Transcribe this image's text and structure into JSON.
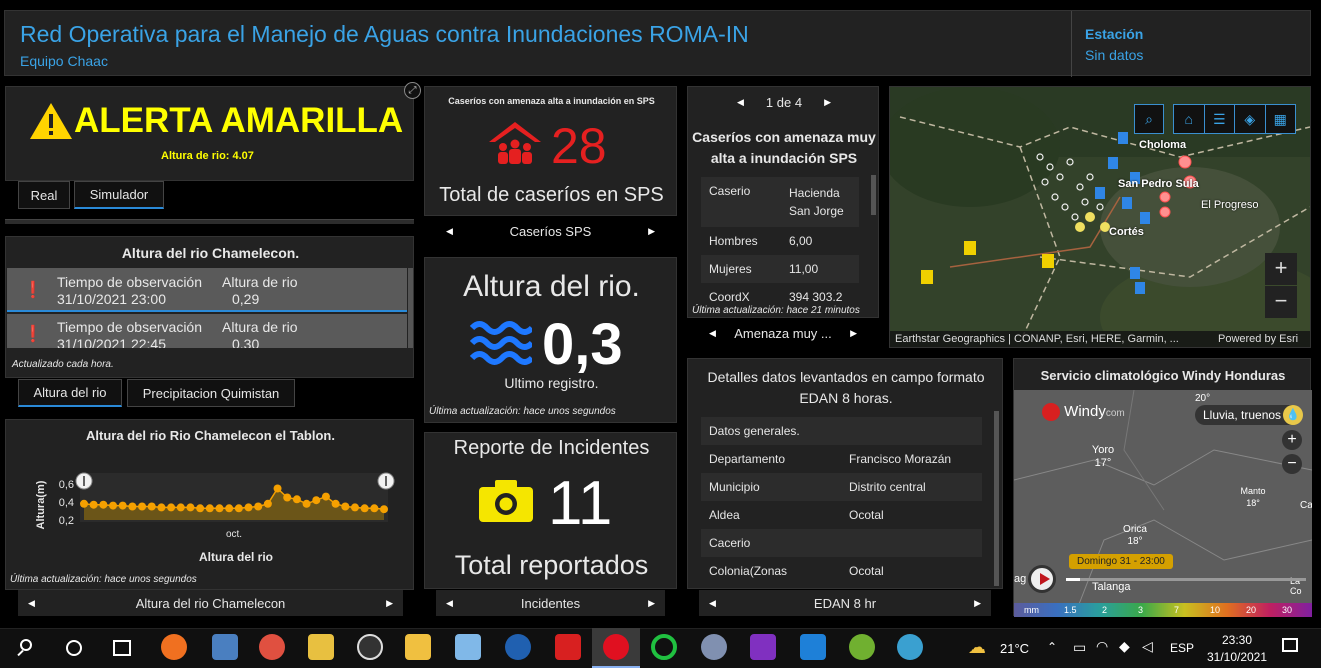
{
  "header": {
    "title": "Red Operativa para el Manejo de Aguas contra Inundaciones ROMA-IN",
    "subtitle": "Equipo Chaac",
    "station_label": "Estación",
    "station_value": "Sin datos"
  },
  "alert": {
    "title": "ALERTA AMARILLA",
    "level_text": "Altura de rio: 4.07",
    "tabs": [
      "Real",
      "Simulador"
    ]
  },
  "river_list": {
    "title": "Altura del rio Chamelecon.",
    "rows": [
      {
        "obs_label": "Tiempo de observación",
        "obs_value": "31/10/2021 23:00",
        "h_label": "Altura de rio",
        "h_value": "0,29"
      },
      {
        "obs_label": "Tiempo de observación",
        "obs_value": "31/10/2021 22:45",
        "h_label": "Altura de rio",
        "h_value": "0,30"
      }
    ],
    "footer": "Actualizado cada hora.",
    "tabs": [
      "Altura del rio",
      "Precipitacion Quimistan"
    ]
  },
  "river_chart": {
    "title": "Altura del rio Rio Chamelecon el Tablon.",
    "footer": "Última actualización: hace unos segundos",
    "nav_label": "Altura del rio Chamelecon"
  },
  "chart_data": {
    "type": "area",
    "title": "Altura del rio Rio Chamelecon el Tablon.",
    "xlabel": "Altura del rio",
    "ylabel": "Altura(m)",
    "x_ticks": [
      "oct."
    ],
    "y_ticks": [
      "0,6",
      "0,4",
      "0,2"
    ],
    "ylim": [
      0.2,
      0.7
    ],
    "series": [
      {
        "name": "",
        "color": "#f5a000",
        "values": [
          0.38,
          0.37,
          0.37,
          0.36,
          0.36,
          0.35,
          0.35,
          0.35,
          0.34,
          0.34,
          0.34,
          0.34,
          0.33,
          0.33,
          0.33,
          0.33,
          0.33,
          0.34,
          0.35,
          0.38,
          0.55,
          0.45,
          0.43,
          0.38,
          0.42,
          0.46,
          0.38,
          0.35,
          0.34,
          0.33,
          0.33,
          0.32
        ]
      }
    ]
  },
  "caserios": {
    "header": "Caseríos con amenaza alta a inundación en SPS",
    "value": "28",
    "total_label": "Total de caseríos en SPS",
    "nav_label": "Caseríos SPS"
  },
  "altura": {
    "title": "Altura del rio.",
    "value": "0,3",
    "sub": "Ultimo registro.",
    "footer": "Última actualización: hace unos segundos"
  },
  "incidentes": {
    "title": "Reporte de Incidentes",
    "value": "11",
    "total_label": "Total reportados",
    "nav_label": "Incidentes"
  },
  "amenaza": {
    "pager": "1 de 4",
    "title": "Caseríos con amenaza muy alta a inundación SPS",
    "rows": [
      {
        "k": "Caserio",
        "v": "Hacienda San Jorge"
      },
      {
        "k": "Hombres",
        "v": "6,00"
      },
      {
        "k": "Mujeres",
        "v": "11,00"
      },
      {
        "k": "CoordX",
        "v": "394 303,2"
      }
    ],
    "footer": "Última actualización: hace 21 minutos",
    "nav_label": "Amenaza muy ..."
  },
  "edan": {
    "title": "Detalles datos levantados en campo formato EDAN 8 horas.",
    "rows": [
      {
        "k": "Datos generales.",
        "v": ""
      },
      {
        "k": "Departamento",
        "v": "Francisco Morazán"
      },
      {
        "k": "Municipio",
        "v": "Distrito central"
      },
      {
        "k": "Aldea",
        "v": "Ocotal"
      },
      {
        "k": "Cacerio",
        "v": ""
      },
      {
        "k": "Colonia(Zonas",
        "v": "Ocotal"
      }
    ],
    "nav_label": "EDAN 8 hr"
  },
  "map": {
    "places": [
      "Choloma",
      "San Pedro Sula",
      "El Progreso",
      "Cortés"
    ],
    "attribution": "Earthstar Geographics | CONANP, Esri, HERE, Garmin, ...",
    "powered": "Powered by Esri",
    "zoom_in": "+",
    "zoom_out": "−"
  },
  "windy": {
    "title": "Servicio climatológico Windy Honduras",
    "logo": "Windy",
    "logo_suffix": "com",
    "weather_chip": "Lluvia, truenos",
    "top_temp": "20°",
    "places": [
      {
        "name": "Yoro",
        "temp": "17°"
      },
      {
        "name": "Manto",
        "temp": "18°"
      },
      {
        "name": "Orica",
        "temp": "18°"
      },
      {
        "name": "Talanga",
        "temp": ""
      }
    ],
    "time_chip": "Domingo 31 - 23:00",
    "left_label": "ag",
    "right_label": "La Co",
    "right_label2": "Ca",
    "scale_unit": "mm",
    "scale_values": [
      "1.5",
      "2",
      "3",
      "7",
      "10",
      "20",
      "30"
    ]
  },
  "taskbar": {
    "temperature": "21°C",
    "language": "ESP",
    "time": "23:30",
    "date": "31/10/2021"
  }
}
